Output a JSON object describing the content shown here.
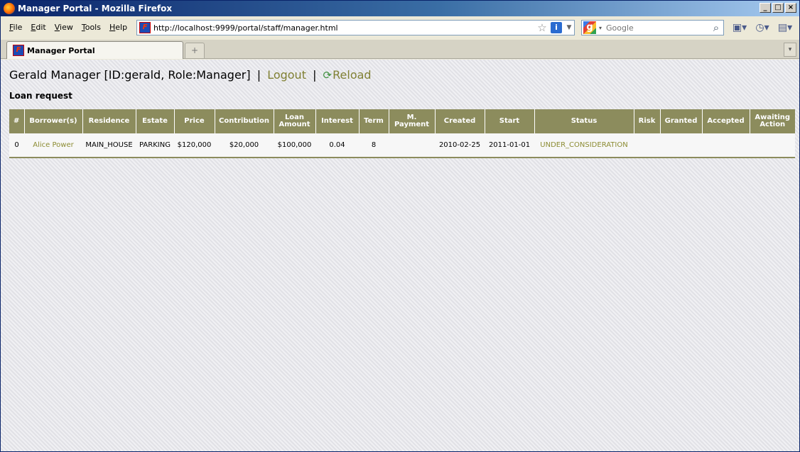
{
  "window": {
    "title": "Manager Portal - Mozilla Firefox",
    "buttons": {
      "minimize": "_",
      "maximize": "□",
      "close": "×"
    }
  },
  "menu": {
    "items": [
      {
        "accel": "F",
        "rest": "ile"
      },
      {
        "accel": "E",
        "rest": "dit"
      },
      {
        "accel": "V",
        "rest": "iew"
      },
      {
        "accel": "T",
        "rest": "ools"
      },
      {
        "accel": "H",
        "rest": "elp"
      }
    ]
  },
  "address": {
    "url": "http://localhost:9999/portal/staff/manager.html"
  },
  "search": {
    "placeholder": "Google"
  },
  "tabs": [
    {
      "label": "Manager Portal"
    }
  ],
  "page": {
    "user_info": "Gerald Manager [ID:gerald, Role:Manager]",
    "separator": "|",
    "logout_label": "Logout",
    "reload_label": "Reload",
    "section_title": "Loan request"
  },
  "table": {
    "headers": [
      "#",
      "Borrower(s)",
      "Residence",
      "Estate",
      "Price",
      "Contribution",
      "Loan Amount",
      "Interest",
      "Term",
      "M. Payment",
      "Created",
      "Start",
      "Status",
      "Risk",
      "Granted",
      "Accepted",
      "Awaiting Action"
    ],
    "rows": [
      {
        "num": "0",
        "borrower": "Alice Power",
        "residence": "MAIN_HOUSE",
        "estate": "PARKING",
        "price": "$120,000",
        "contribution": "$20,000",
        "loan_amount": "$100,000",
        "interest": "0.04",
        "term": "8",
        "m_payment": "",
        "created": "2010-02-25",
        "start": "2011-01-01",
        "status": "UNDER_CONSIDERATION",
        "risk": "",
        "granted": "",
        "accepted": "",
        "awaiting_action": ""
      }
    ]
  },
  "colors": {
    "header_bg": "#8c8c5d",
    "link": "#808033",
    "title_bar": "#0a246a"
  }
}
